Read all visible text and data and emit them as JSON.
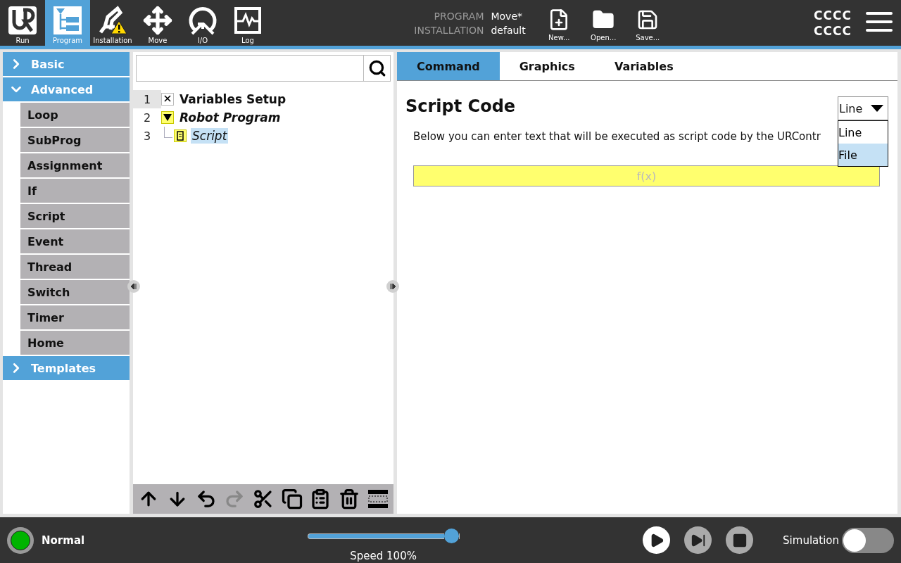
{
  "nav": [
    {
      "kind": "run",
      "label": "Run",
      "selected": false
    },
    {
      "kind": "program",
      "label": "Program",
      "selected": true
    },
    {
      "kind": "installation",
      "label": "Installation",
      "selected": false
    },
    {
      "kind": "move",
      "label": "Move",
      "selected": false
    },
    {
      "kind": "io",
      "label": "I/O",
      "selected": false
    },
    {
      "kind": "log",
      "label": "Log",
      "selected": false
    }
  ],
  "file_info": [
    {
      "label": "PROGRAM",
      "value": "Move*"
    },
    {
      "label": "INSTALLATION",
      "value": "default"
    }
  ],
  "file_buttons": [
    {
      "kind": "new",
      "label": "New..."
    },
    {
      "kind": "open",
      "label": "Open..."
    },
    {
      "kind": "save",
      "label": "Save..."
    }
  ],
  "user_lines": [
    "CCCC",
    "CCCC"
  ],
  "sidebar": [
    {
      "label": "Basic",
      "expanded": false
    },
    {
      "label": "Advanced",
      "expanded": true,
      "children": [
        "Loop",
        "SubProg",
        "Assignment",
        "If",
        "Script",
        "Event",
        "Thread",
        "Switch",
        "Timer",
        "Home"
      ]
    },
    {
      "label": "Templates",
      "expanded": false
    }
  ],
  "tree": [
    {
      "number": "1",
      "kind": "variables",
      "label": "Variables Setup",
      "selected": false,
      "focused": true
    },
    {
      "number": "2",
      "kind": "program",
      "label": "Robot Program",
      "selected": false,
      "focused": false,
      "expanded": true,
      "children": [
        {
          "number": "3",
          "kind": "script",
          "label": "Script",
          "selected": true,
          "focused": false
        }
      ]
    }
  ],
  "tree_toolbar": [
    {
      "kind": "up",
      "disabled": false
    },
    {
      "kind": "down",
      "disabled": false
    },
    {
      "kind": "undo",
      "disabled": false
    },
    {
      "kind": "redo",
      "disabled": true
    },
    {
      "kind": "cut",
      "disabled": false
    },
    {
      "kind": "copy",
      "disabled": false
    },
    {
      "kind": "paste",
      "disabled": false
    },
    {
      "kind": "delete",
      "disabled": false
    },
    {
      "kind": "suppress",
      "disabled": false
    }
  ],
  "tabs": [
    {
      "label": "Command",
      "selected": true
    },
    {
      "label": "Graphics",
      "selected": false
    },
    {
      "label": "Variables",
      "selected": false
    }
  ],
  "command": {
    "title": "Script Code",
    "description": "Below you can enter text that will be executed as script code by the URContr",
    "mode": {
      "value": "Line",
      "open": true,
      "options": [
        {
          "label": "Line",
          "highlighted": false
        },
        {
          "label": "File",
          "highlighted": true
        }
      ]
    },
    "expression": {
      "placeholder": "f(x)"
    }
  },
  "status": {
    "label": "Normal",
    "color": "#00b400"
  },
  "speed": {
    "level": 1.0,
    "label": "Speed 100%"
  },
  "controls": [
    {
      "kind": "play",
      "disabled": false
    },
    {
      "kind": "step",
      "disabled": true
    },
    {
      "kind": "stop",
      "disabled": true
    }
  ],
  "simulation": {
    "label": "Simulation",
    "on": false
  }
}
